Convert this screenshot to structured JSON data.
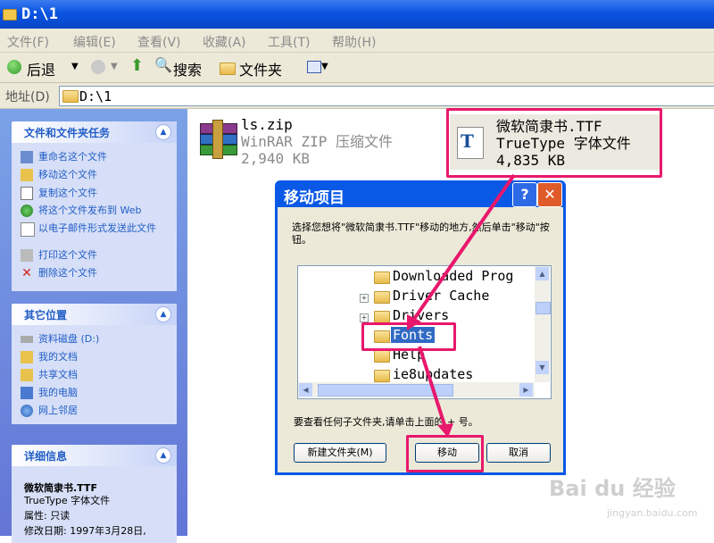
{
  "window": {
    "title": "D:\\1"
  },
  "menu": [
    "文件(F)",
    "编辑(E)",
    "查看(V)",
    "收藏(A)",
    "工具(T)",
    "帮助(H)"
  ],
  "toolbar": {
    "back": "后退",
    "search": "搜索",
    "folders": "文件夹"
  },
  "address": {
    "label": "地址(D)",
    "path": "D:\\1"
  },
  "tasks_panel": {
    "title": "文件和文件夹任务",
    "items": [
      "重命名这个文件",
      "移动这个文件",
      "复制这个文件",
      "将这个文件发布到 Web",
      "以电子邮件形式发送此文件",
      "打印这个文件",
      "删除这个文件"
    ]
  },
  "places_panel": {
    "title": "其它位置",
    "items": [
      "资料磁盘 (D:)",
      "我的文档",
      "共享文档",
      "我的电脑",
      "网上邻居"
    ]
  },
  "details_panel": {
    "title": "详细信息",
    "name": "微软简隶书.TTF",
    "type": "TrueType 字体文件",
    "attr": "属性: 只读",
    "modified": "修改日期: 1997年3月28日,"
  },
  "files": [
    {
      "name": "ls.zip",
      "type": "WinRAR ZIP 压缩文件",
      "size": "2,940 KB"
    },
    {
      "name": "微软简隶书.TTF",
      "type": "TrueType 字体文件",
      "size": "4,835 KB"
    }
  ],
  "dialog": {
    "title": "移动项目",
    "instruction": "选择您想将\"微软简隶书.TTF\"移动的地方,然后单击\"移动\"按钮。",
    "tree": [
      "Downloaded Prog",
      "Driver Cache",
      "Drivers",
      "Fonts",
      "Help",
      "ie8updates"
    ],
    "hint": "要查看任何子文件夹,请单击上面的 + 号。",
    "new_folder": "新建文件夹(M)",
    "move": "移动",
    "cancel": "取消",
    "help": "?",
    "close": "✕"
  },
  "watermark": {
    "brand": "Bai du 经验",
    "url": "jingyan.baidu.com"
  },
  "colors": {
    "xp_blue": "#0a54e0",
    "highlight": "#e8186c",
    "link": "#215dc6"
  }
}
